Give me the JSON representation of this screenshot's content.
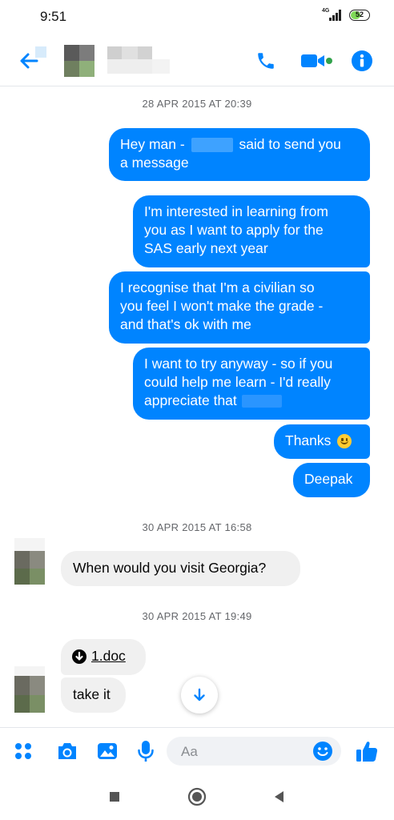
{
  "status_bar": {
    "time": "9:51",
    "network": "4G",
    "battery": "52",
    "battery_level": 0.52
  },
  "header": {
    "back_icon": "back-arrow-icon",
    "call_icon": "phone-icon",
    "video_icon": "video-camera-icon",
    "info_icon": "info-icon"
  },
  "colors": {
    "accent": "#0084ff",
    "bubble_in": "#f0f0f0",
    "timestamp": "#65676b",
    "online": "#31a24c"
  },
  "conversation": {
    "timestamps": [
      "28 APR 2015 AT 20:39",
      "30 APR 2015 AT 16:58",
      "30 APR 2015 AT 19:49"
    ],
    "outgoing": [
      {
        "part1": "Hey man - ",
        "part2": " said to send you",
        "part3": "a message"
      },
      {
        "text_lines": [
          "I'm interested in learning from",
          "you as I want to apply for the",
          "SAS early next year"
        ]
      },
      {
        "text_lines": [
          "I recognise that I'm a civilian so",
          "you feel I won't make the grade -",
          "and that's ok with me"
        ]
      },
      {
        "line1": "I want to try anyway - so if you",
        "line2": "could help me learn - I'd really",
        "line3": "appreciate that"
      },
      {
        "text": "Thanks",
        "emoji": "slightly-smiling-face"
      },
      {
        "text": "Deepak"
      }
    ],
    "incoming": [
      {
        "text": "When would you visit Georgia?"
      },
      {
        "file_name": "1.doc",
        "icon": "download-circle-icon"
      },
      {
        "text": "take it"
      }
    ]
  },
  "composer": {
    "placeholder": "Aa"
  }
}
